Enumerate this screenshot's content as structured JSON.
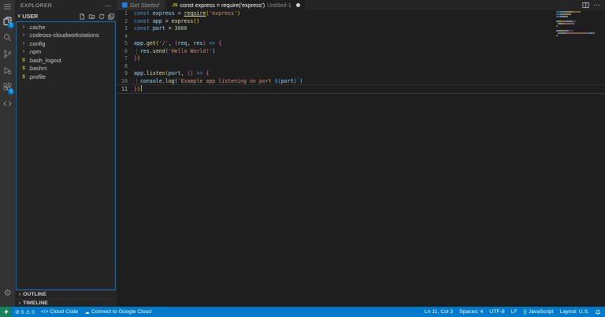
{
  "colors": {
    "accent": "#007ACC",
    "remote": "#16825D",
    "focus_border": "#0E70C0",
    "keyword": "#569CD6",
    "variable": "#9CDCFE",
    "function": "#DCDCAA",
    "string": "#CE9178",
    "number": "#B5CEA8",
    "punctuation": "#D4D4D4",
    "bracket1": "#FFD700",
    "bracket2": "#DA70D6",
    "bracket3": "#87CEFA",
    "shell_icon": "#9CBA3B"
  },
  "glyphs": {
    "chevron": "›",
    "shell": "$",
    "gear": "⚙",
    "more": "⋯",
    "section_chevron": "∨"
  },
  "activity_bar": {
    "items": [
      {
        "name": "menu"
      },
      {
        "name": "explorer",
        "active": true,
        "badge": "1"
      },
      {
        "name": "search"
      },
      {
        "name": "source-control"
      },
      {
        "name": "run-and-debug"
      },
      {
        "name": "extensions",
        "badge": "1"
      },
      {
        "name": "cloud-code"
      }
    ],
    "bottom": [
      {
        "name": "manage"
      }
    ]
  },
  "sidebar": {
    "title": "EXPLORER",
    "section": {
      "label": "USER"
    },
    "tree": [
      {
        "icon": "chevron",
        "label": ".cache"
      },
      {
        "icon": "chevron",
        "label": ".codeoss-cloudworkstations"
      },
      {
        "icon": "chevron",
        "label": ".config"
      },
      {
        "icon": "chevron",
        "label": ".npm"
      },
      {
        "icon": "shell",
        "label": ".bash_logout"
      },
      {
        "icon": "shell",
        "label": ".bashrc"
      },
      {
        "icon": "shell",
        "label": ".profile"
      }
    ],
    "panels": [
      {
        "label": "OUTLINE"
      },
      {
        "label": "TIMELINE"
      }
    ]
  },
  "tab_bar": {
    "tabs": [
      {
        "name": "tab-get-started",
        "label": "Get Started",
        "preview": true
      },
      {
        "name": "tab-untitled-1",
        "icon_text": "JS",
        "label": "const express = require('express')",
        "detail": "Untitled-1",
        "dirty": true,
        "active": true
      }
    ]
  },
  "editor": {
    "current_line": 11,
    "lines": [
      {
        "num": 1,
        "tokens": [
          [
            "k",
            "const "
          ],
          [
            "v",
            "express"
          ],
          [
            "p",
            " = "
          ],
          [
            "fu",
            "require"
          ],
          [
            "b1",
            "("
          ],
          [
            "s",
            "'express'"
          ],
          [
            "b1",
            ")"
          ]
        ]
      },
      {
        "num": 2,
        "tokens": [
          [
            "k",
            "const "
          ],
          [
            "v",
            "app"
          ],
          [
            "p",
            " = "
          ],
          [
            "f",
            "express"
          ],
          [
            "b1",
            "("
          ],
          [
            "b1",
            ")"
          ]
        ]
      },
      {
        "num": 3,
        "tokens": [
          [
            "k",
            "const "
          ],
          [
            "v",
            "port"
          ],
          [
            "p",
            " = "
          ],
          [
            "n",
            "3000"
          ]
        ]
      },
      {
        "num": 4,
        "tokens": []
      },
      {
        "num": 5,
        "tokens": [
          [
            "v",
            "app"
          ],
          [
            "p",
            "."
          ],
          [
            "f",
            "get"
          ],
          [
            "b1",
            "("
          ],
          [
            "s",
            "'/'"
          ],
          [
            "p",
            ", "
          ],
          [
            "b2",
            "("
          ],
          [
            "v",
            "req"
          ],
          [
            "p",
            ", "
          ],
          [
            "v",
            "res"
          ],
          [
            "b2",
            ")"
          ],
          [
            "p",
            " "
          ],
          [
            "k",
            "=>"
          ],
          [
            "p",
            " "
          ],
          [
            "b2",
            "{"
          ]
        ]
      },
      {
        "num": 6,
        "guide": true,
        "tokens": [
          [
            "p",
            "  "
          ],
          [
            "v",
            "res"
          ],
          [
            "p",
            "."
          ],
          [
            "f",
            "send"
          ],
          [
            "b3",
            "("
          ],
          [
            "s",
            "'Hello World!'"
          ],
          [
            "b3",
            ")"
          ]
        ]
      },
      {
        "num": 7,
        "tokens": [
          [
            "b2",
            "}"
          ],
          [
            "b1",
            ")"
          ]
        ]
      },
      {
        "num": 8,
        "tokens": []
      },
      {
        "num": 9,
        "tokens": [
          [
            "v",
            "app"
          ],
          [
            "p",
            "."
          ],
          [
            "f",
            "listen"
          ],
          [
            "b1",
            "("
          ],
          [
            "v",
            "port"
          ],
          [
            "p",
            ", "
          ],
          [
            "b2",
            "("
          ],
          [
            "b2",
            ")"
          ],
          [
            "p",
            " "
          ],
          [
            "k",
            "=>"
          ],
          [
            "p",
            " "
          ],
          [
            "b2",
            "{"
          ]
        ]
      },
      {
        "num": 10,
        "guide": true,
        "tokens": [
          [
            "p",
            "  "
          ],
          [
            "v",
            "console"
          ],
          [
            "p",
            "."
          ],
          [
            "f",
            "log"
          ],
          [
            "b3",
            "("
          ],
          [
            "s",
            "`Example app listening on port "
          ],
          [
            "k",
            "${"
          ],
          [
            "v",
            "port"
          ],
          [
            "k",
            "}"
          ],
          [
            "s",
            "`"
          ],
          [
            "b3",
            ")"
          ]
        ]
      },
      {
        "num": 11,
        "cursor": true,
        "tokens": [
          [
            "b2",
            "}"
          ],
          [
            "b1",
            ")"
          ]
        ]
      }
    ]
  },
  "status_bar": {
    "left": [
      {
        "name": "problems-indicator",
        "label": "⊘ 0  ⚠ 0"
      },
      {
        "name": "cloud-code-status",
        "glyph": "</>",
        "label": "Cloud Code"
      },
      {
        "name": "connect-google-cloud",
        "glyph": "☁",
        "label": "Connect to Google Cloud"
      }
    ],
    "right": [
      {
        "name": "cursor-position",
        "label": "Ln 11, Col 3"
      },
      {
        "name": "indentation",
        "label": "Spaces: 4"
      },
      {
        "name": "encoding",
        "label": "UTF-8"
      },
      {
        "name": "eol-sequence",
        "label": "LF"
      },
      {
        "name": "language-mode",
        "glyph": "{}",
        "label": "JavaScript"
      },
      {
        "name": "keyboard-layout",
        "label": "Layout: U.S."
      }
    ]
  }
}
